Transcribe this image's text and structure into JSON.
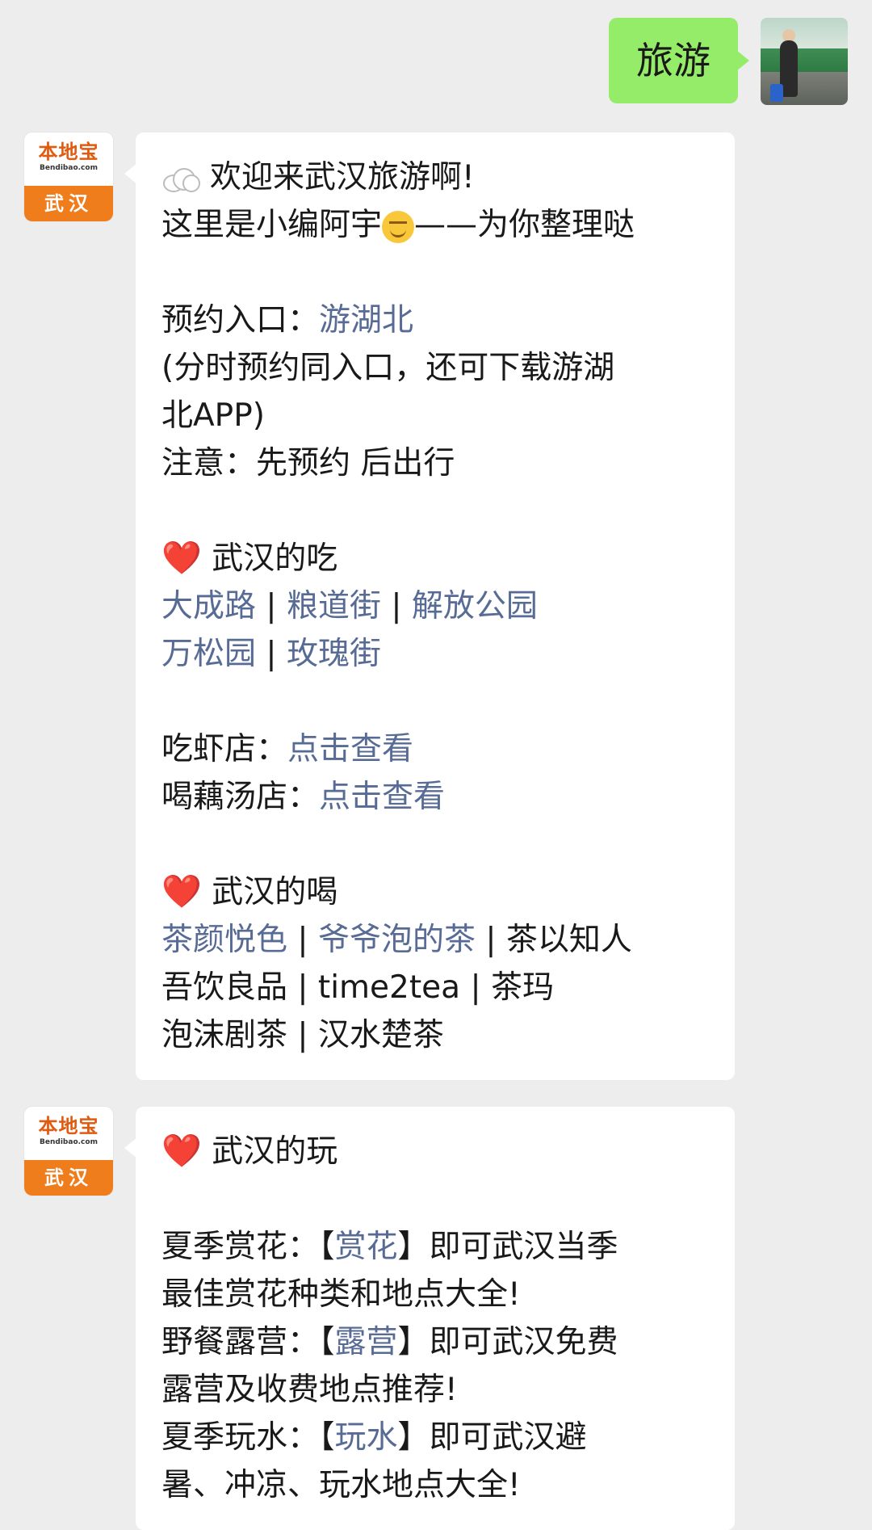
{
  "outgoing": {
    "text": "旅游"
  },
  "bot": {
    "logo_text": "本地宝",
    "logo_domain": "Bendibao.com",
    "logo_city": "武汉"
  },
  "message1": {
    "greeting": "欢迎来武汉旅游啊!",
    "intro_a": "这里是小编阿宇",
    "intro_b": "——为你整理哒",
    "reserve_label": "预约入口：",
    "reserve_link": "游湖北",
    "reserve_note_1": "(分时预约同入口，还可下载游湖",
    "reserve_note_2": "北APP)",
    "notice": "注意：先预约 后出行",
    "eat_heading": "武汉的吃",
    "eat_line1": [
      "大成路",
      "粮道街",
      "解放公园"
    ],
    "eat_line2": [
      "万松园",
      "玫瑰街"
    ],
    "shrimp_label": "吃虾店：",
    "shrimp_link": "点击查看",
    "soup_label": "喝藕汤店：",
    "soup_link": "点击查看",
    "drink_heading": "武汉的喝",
    "drink_link1": "茶颜悦色",
    "drink_link2": "爷爷泡的茶",
    "drink_text1": "茶以知人",
    "drink_line2": "吾饮良品 | time2tea | 茶玛",
    "drink_line3": "泡沫剧茶 | 汉水楚茶"
  },
  "message2": {
    "play_heading": "武汉的玩",
    "flower_label": "夏季赏花：【",
    "flower_link": "赏花",
    "flower_tail": "】即可武汉当季",
    "flower_line2": "最佳赏花种类和地点大全!",
    "camp_label": "野餐露营：【",
    "camp_link": "露营",
    "camp_tail": "】即可武汉免费",
    "camp_line2": "露营及收费地点推荐!",
    "water_label": "夏季玩水：【",
    "water_link": "玩水",
    "water_tail": "】即可武汉避",
    "water_line2": "暑、冲凉、玩水地点大全!"
  },
  "colors": {
    "link": "#576b95",
    "outgoing_bubble": "#95ec69",
    "logo_orange": "#f07d1c"
  }
}
